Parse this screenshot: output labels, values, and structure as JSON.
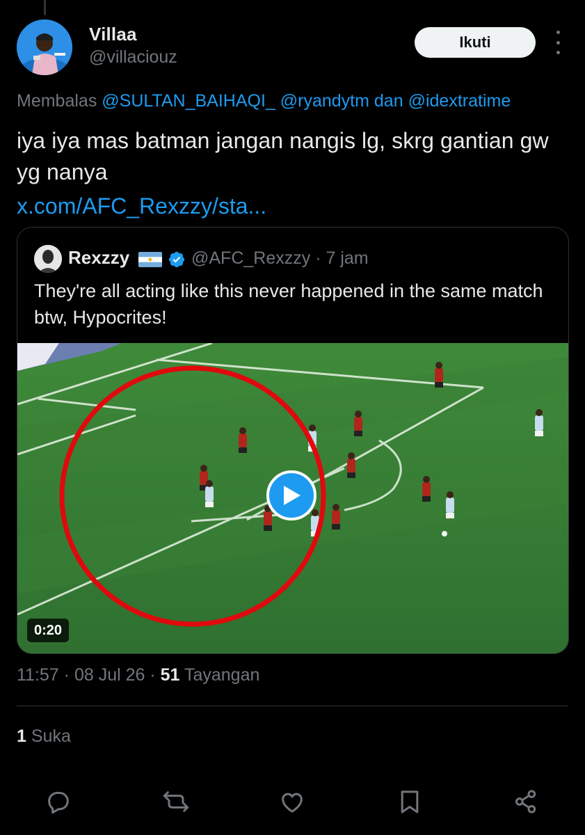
{
  "author": {
    "display_name": "Villaa",
    "handle": "@villaciouz",
    "avatar_icon": "avatar-icon"
  },
  "follow_button": {
    "label": "Ikuti"
  },
  "reply": {
    "prefix": "Membalas",
    "mentions": [
      "@SULTAN_BAIHAQI_",
      "@ryandytm",
      "@idextratime"
    ],
    "conjunction": "dan"
  },
  "tweet": {
    "text": "iya iya mas batman jangan nangis lg, skrg gantian gw yg nanya",
    "link": "x.com/AFC_Rexzzy/sta..."
  },
  "quote": {
    "display_name": "Rexzzy",
    "handle": "@AFC_Rexzzy",
    "time": "· 7 jam",
    "text": "They're all acting like this never happened in the same match btw,  Hypocrites!",
    "video_duration": "0:20",
    "flag_icon": "argentina-flag-icon",
    "verified_icon": "verified-badge-icon"
  },
  "meta": {
    "time": "11:57",
    "date": "08 Jul 26",
    "views_count": "51",
    "views_label": "Tayangan",
    "separator": "·"
  },
  "likes": {
    "count": "1",
    "label": "Suka"
  },
  "actions": [
    "reply-icon",
    "retweet-icon",
    "like-icon",
    "bookmark-icon",
    "share-icon"
  ],
  "colors": {
    "background": "#000000",
    "text": "#e7e9ea",
    "secondary": "#71767b",
    "accent": "#1d9bf0",
    "border": "#2f3336"
  }
}
